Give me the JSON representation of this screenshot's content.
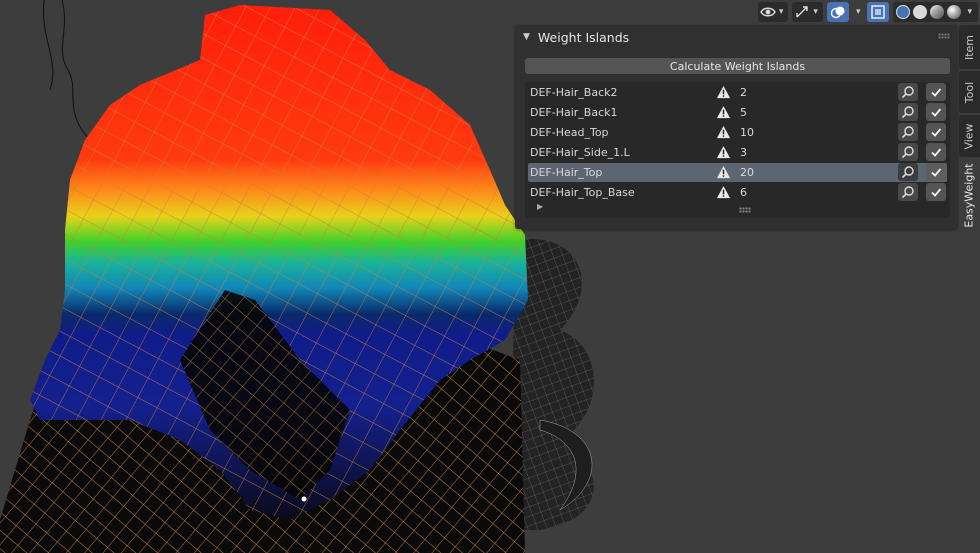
{
  "header": {
    "icons": [
      "eye-visibility-icon",
      "gizmo-icon",
      "overlay-icon",
      "xray-icon",
      "wireframe-shading-icon",
      "solid-shading-icon",
      "material-shading-icon",
      "rendered-shading-icon"
    ]
  },
  "panel": {
    "title": "Weight Islands",
    "calculate_button": "Calculate Weight Islands",
    "rows": [
      {
        "name": "DEF-Hair_Back2",
        "count": "2",
        "selected": false
      },
      {
        "name": "DEF-Hair_Back1",
        "count": "5",
        "selected": false
      },
      {
        "name": "DEF-Head_Top",
        "count": "10",
        "selected": false
      },
      {
        "name": "DEF-Hair_Side_1.L",
        "count": "3",
        "selected": false
      },
      {
        "name": "DEF-Hair_Top",
        "count": "20",
        "selected": true
      },
      {
        "name": "DEF-Hair_Top_Base",
        "count": "6",
        "selected": false
      }
    ]
  },
  "tabs": [
    "Item",
    "Tool",
    "View",
    "EasyWeight"
  ],
  "active_tab": "EasyWeight",
  "colors": {
    "accent": "#4772b3",
    "panel_bg": "#303030",
    "viewport_bg": "#3d3d3d",
    "selected_row": "#5c6672",
    "wire": "#e8913a"
  }
}
